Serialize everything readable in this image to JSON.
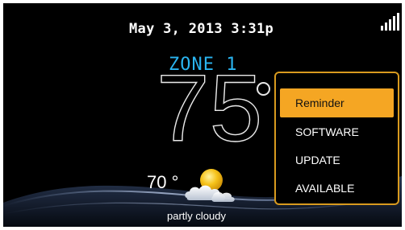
{
  "status_bar": {
    "datetime": "May 3, 2013 3:31p",
    "signal_icon": "signal-strength-icon"
  },
  "zone": {
    "name": "ZONE 1",
    "temperature": "75"
  },
  "weather": {
    "outdoor_temperature": "70 °",
    "condition": "partly cloudy",
    "icon": "partly-cloudy-icon"
  },
  "notification": {
    "title": "Reminder",
    "lines": [
      "SOFTWARE",
      "UPDATE",
      "AVAILABLE"
    ]
  },
  "colors": {
    "zone_label": "#2ab4f0",
    "popup_accent": "#f5a623",
    "popup_border": "#d89a1e",
    "background": "#000000"
  }
}
